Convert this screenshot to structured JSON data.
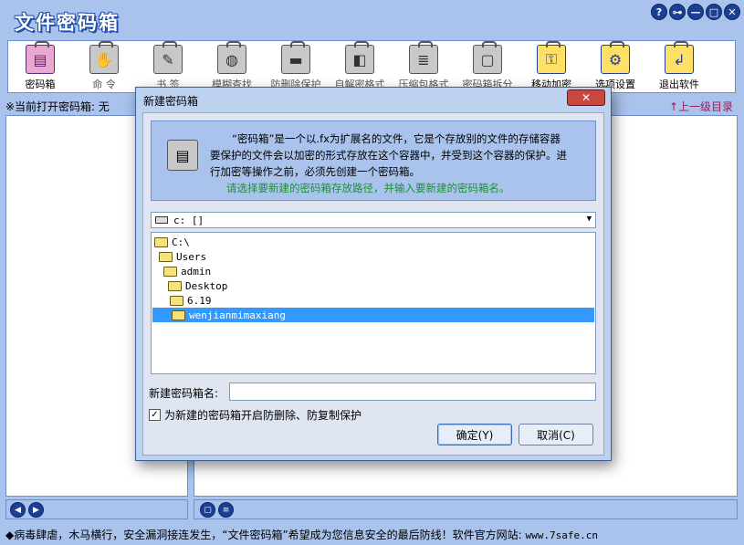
{
  "app": {
    "title": "文件密码箱",
    "controls": [
      "?",
      "⊶",
      "—",
      "□",
      "✕"
    ]
  },
  "toolbar": {
    "items": [
      {
        "label": "密码箱",
        "icon": "lock-box-icon"
      },
      {
        "label": "命 令",
        "icon": "command-icon"
      },
      {
        "label": "书 签",
        "icon": "bookmark-icon"
      },
      {
        "label": "模糊查找",
        "icon": "search-icon"
      },
      {
        "label": "防删除保护",
        "icon": "shield-icon"
      },
      {
        "label": "自解密格式",
        "icon": "self-decrypt-icon"
      },
      {
        "label": "压缩包格式",
        "icon": "archive-icon"
      },
      {
        "label": "密码箱拆分",
        "icon": "split-icon"
      },
      {
        "label": "移动加密",
        "icon": "mobile-encrypt-icon"
      },
      {
        "label": "选项设置",
        "icon": "settings-icon"
      },
      {
        "label": "退出软件",
        "icon": "exit-icon"
      }
    ]
  },
  "status": {
    "current": "※当前打开密码箱: 无",
    "up_level": "↑上一级目录"
  },
  "footer": {
    "text": "◆病毒肆虐，木马横行，安全漏洞接连发生，“文件密码箱”希望成为您信息安全的最后防线！软件官方网站: ",
    "url": "www.7safe.cn"
  },
  "dialog": {
    "title": "新建密码箱",
    "close": "✕",
    "info_line1": "“密码箱”是一个以.fx为扩展名的文件，它是个存放别的文件的存储容器",
    "info_line2": "要保护的文件会以加密的形式存放在这个容器中，并受到这个容器的保护。进",
    "info_line3": "行加密等操作之前，必须先创建一个密码箱。",
    "info_line4": "请选择要新建的密码箱存放路径，并输入要新建的密码箱名。",
    "drive": "c: []",
    "tree": [
      {
        "label": "C:\\",
        "level": 0
      },
      {
        "label": "Users",
        "level": 1
      },
      {
        "label": "admin",
        "level": 2
      },
      {
        "label": "Desktop",
        "level": 3
      },
      {
        "label": "6.19",
        "level": 4
      },
      {
        "label": "wenjianmimaxiang",
        "level": 5,
        "selected": true
      }
    ],
    "name_label": "新建密码箱名:",
    "name_value": "",
    "checkbox_label": "为新建的密码箱开启防删除、防复制保护",
    "checkbox_checked": true,
    "ok_label": "确定(Y)",
    "cancel_label": "取消(C)"
  },
  "colors": {
    "background": "#a9c3ec",
    "selection": "#3399ff",
    "accent_green": "#1f8f3a",
    "close_red": "#c8473f"
  }
}
